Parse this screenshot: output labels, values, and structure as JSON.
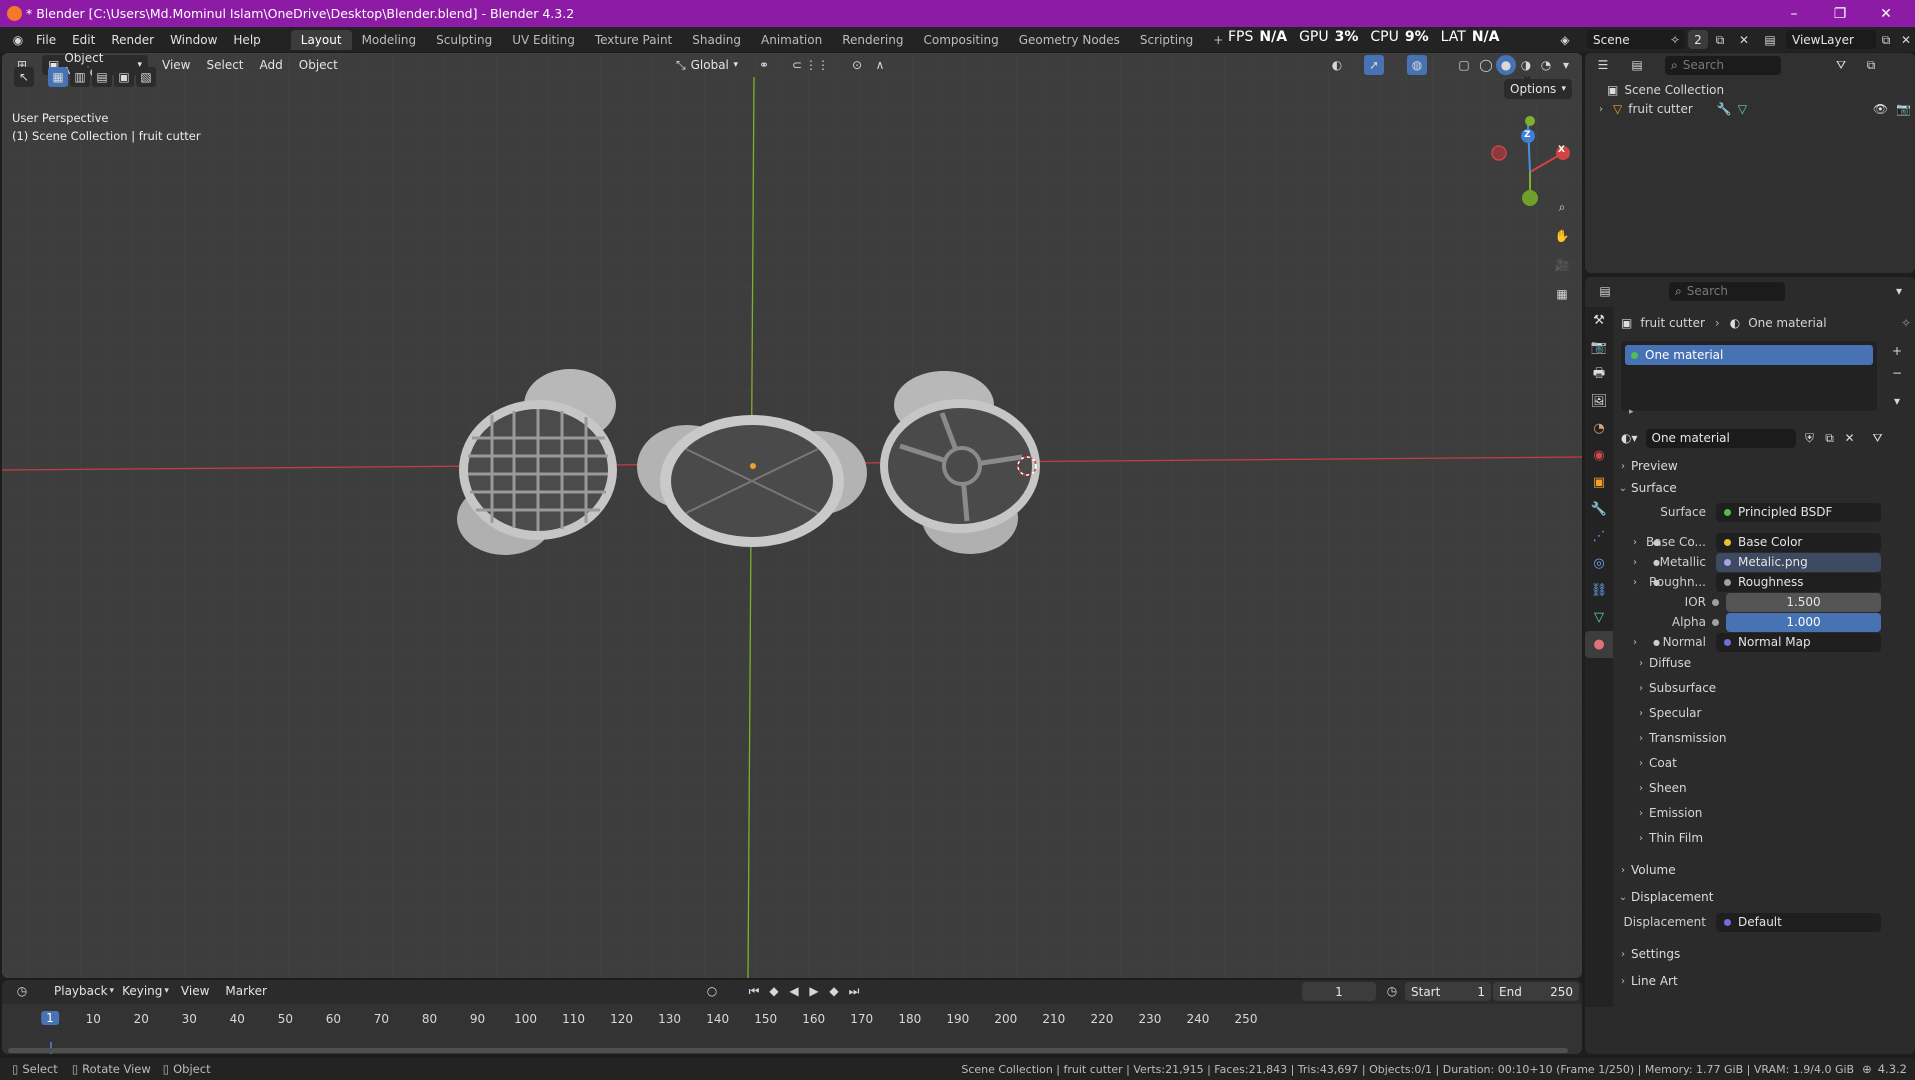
{
  "window": {
    "title": "* Blender [C:\\Users\\Md.Mominul Islam\\OneDrive\\Desktop\\Blender.blend] - Blender 4.3.2",
    "controls": [
      "–",
      "❐",
      "✕"
    ]
  },
  "menu": [
    "File",
    "Edit",
    "Render",
    "Window",
    "Help"
  ],
  "workspaces": [
    {
      "label": "Layout",
      "active": true
    },
    {
      "label": "Modeling"
    },
    {
      "label": "Sculpting"
    },
    {
      "label": "UV Editing"
    },
    {
      "label": "Texture Paint"
    },
    {
      "label": "Shading"
    },
    {
      "label": "Animation"
    },
    {
      "label": "Rendering"
    },
    {
      "label": "Compositing"
    },
    {
      "label": "Geometry Nodes"
    },
    {
      "label": "Scripting"
    },
    {
      "label": "+"
    }
  ],
  "stats": {
    "fps_label": "FPS",
    "fps_value": "N/A",
    "gpu_label": "GPU",
    "gpu_value": "3%",
    "cpu_label": "CPU",
    "cpu_value": "9%",
    "lat_label": "LAT",
    "lat_value": "N/A"
  },
  "scene": {
    "name": "Scene",
    "users": "2",
    "view_layer": "ViewLayer"
  },
  "viewport": {
    "mode": "Object Mode",
    "menus": [
      "View",
      "Select",
      "Add",
      "Object"
    ],
    "orientation": "Global",
    "options_label": "Options",
    "overlay_line1": "User Perspective",
    "overlay_line2": "(1) Scene Collection | fruit cutter",
    "gizmo": {
      "x": "X",
      "y": "Y",
      "z": "Z"
    }
  },
  "outliner": {
    "search_placeholder": "Search",
    "root": "Scene Collection",
    "items": [
      {
        "label": "fruit cutter"
      }
    ]
  },
  "properties": {
    "search_placeholder": "Search",
    "breadcrumb_object": "fruit cutter",
    "breadcrumb_material": "One material",
    "slot": "One material",
    "material_name": "One material",
    "sections": {
      "preview": "Preview",
      "surface": "Surface",
      "volume": "Volume",
      "displacement": "Displacement",
      "settings": "Settings",
      "line_art": "Line Art"
    },
    "surface_rows": [
      {
        "label": "Surface",
        "value": "Principled BSDF",
        "dot": "#4fc04f"
      },
      {
        "label": "Base Co...",
        "value": "Base Color",
        "dot": "#e5c22e"
      },
      {
        "label": "Metallic",
        "value": "Metalic.png",
        "dot": "#a5a5e5"
      },
      {
        "label": "Roughn...",
        "value": "Roughness",
        "dot": "#a0a0a0"
      },
      {
        "label": "IOR",
        "value": "1.500",
        "dot": "#a0a0a0"
      },
      {
        "label": "Alpha",
        "value": "1.000",
        "dot": "#a0a0a0"
      },
      {
        "label": "Normal",
        "value": "Normal Map",
        "dot": "#6f6fd8"
      }
    ],
    "subpanels": [
      "Diffuse",
      "Subsurface",
      "Specular",
      "Transmission",
      "Coat",
      "Sheen",
      "Emission",
      "Thin Film"
    ],
    "displacement_row": {
      "label": "Displacement",
      "value": "Default",
      "dot": "#6f6fd8"
    }
  },
  "timeline": {
    "menus": [
      "Playback",
      "Keying",
      "View",
      "Marker"
    ],
    "current_frame": "1",
    "start_label": "Start",
    "start": "1",
    "end_label": "End",
    "end": "250",
    "ticks": [
      "1",
      "10",
      "20",
      "30",
      "40",
      "50",
      "60",
      "70",
      "80",
      "90",
      "100",
      "110",
      "120",
      "130",
      "140",
      "150",
      "160",
      "170",
      "180",
      "190",
      "200",
      "210",
      "220",
      "230",
      "240",
      "250"
    ]
  },
  "statusbar": {
    "select": "Select",
    "rotate": "Rotate View",
    "object": "Object",
    "info": "Scene Collection | fruit cutter | Verts:21,915 | Faces:21,843 | Tris:43,697 | Objects:0/1 | Duration: 00:10+10 (Frame 1/250) | Memory: 1.77 GiB | VRAM: 1.9/4.0 GiB",
    "version": "4.3.2"
  },
  "colors": {
    "accent": "#4772b3",
    "titlebar": "#8d1ba6",
    "axis_x": "#c43c44",
    "axis_y": "#7fb02a"
  }
}
